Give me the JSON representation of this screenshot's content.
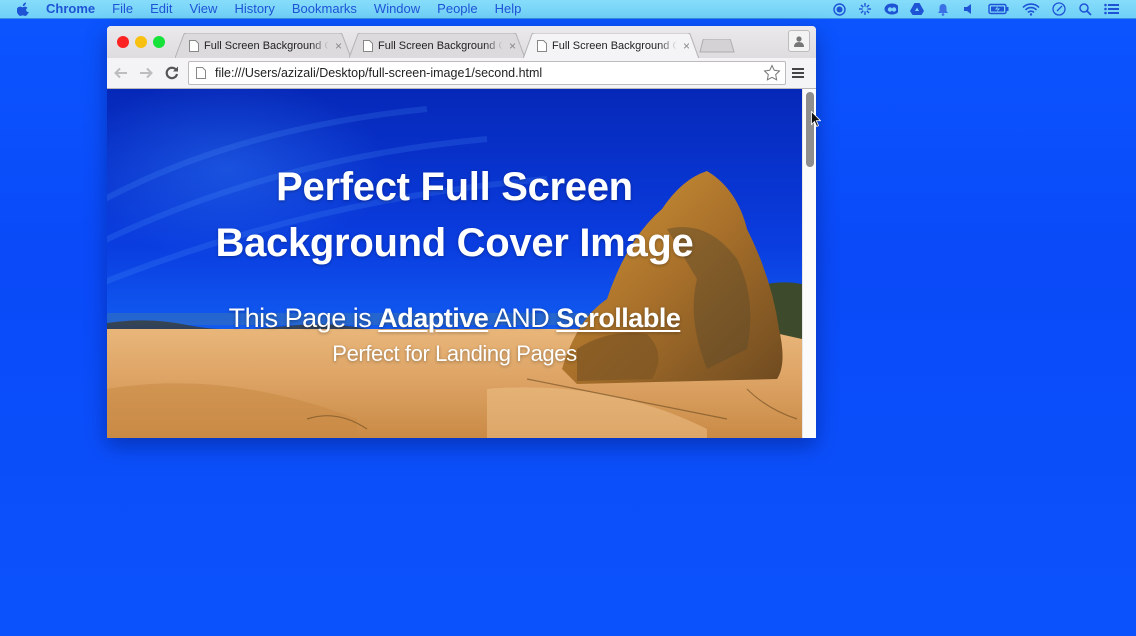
{
  "menubar": {
    "apple_icon": "apple-logo",
    "items": [
      "Chrome",
      "File",
      "Edit",
      "View",
      "History",
      "Bookmarks",
      "Window",
      "People",
      "Help"
    ],
    "status_icons": [
      "record-icon",
      "brightness-icon",
      "creative-cloud-icon",
      "google-drive-icon",
      "notification-bell-icon",
      "volume-icon",
      "battery-icon",
      "wifi-icon",
      "clock-icon",
      "spotlight-search-icon",
      "notification-center-icon"
    ]
  },
  "browser": {
    "tabs": [
      {
        "title": "Full Screen Background Cover Image",
        "active": false
      },
      {
        "title": "Full Screen Background Cover Image",
        "active": false
      },
      {
        "title": "Full Screen Background Cover Image",
        "active": true
      }
    ],
    "close_glyph": "×",
    "url": "file:///Users/azizali/Desktop/full-screen-image1/second.html"
  },
  "page": {
    "heading_line1": "Perfect Full Screen",
    "heading_line2": "Background Cover Image",
    "sub_prefix": "This Page is ",
    "sub_adaptive": "Adaptive",
    "sub_and": " AND ",
    "sub_scrollable": "Scrollable",
    "tagline": "Perfect for Landing Pages",
    "scroll_position_fraction": 0.0,
    "colors": {
      "sky": "#0a3fe0",
      "sand": "#e3ad6e",
      "rock": "#b7782a",
      "desktop": "#0a4dfb"
    }
  }
}
